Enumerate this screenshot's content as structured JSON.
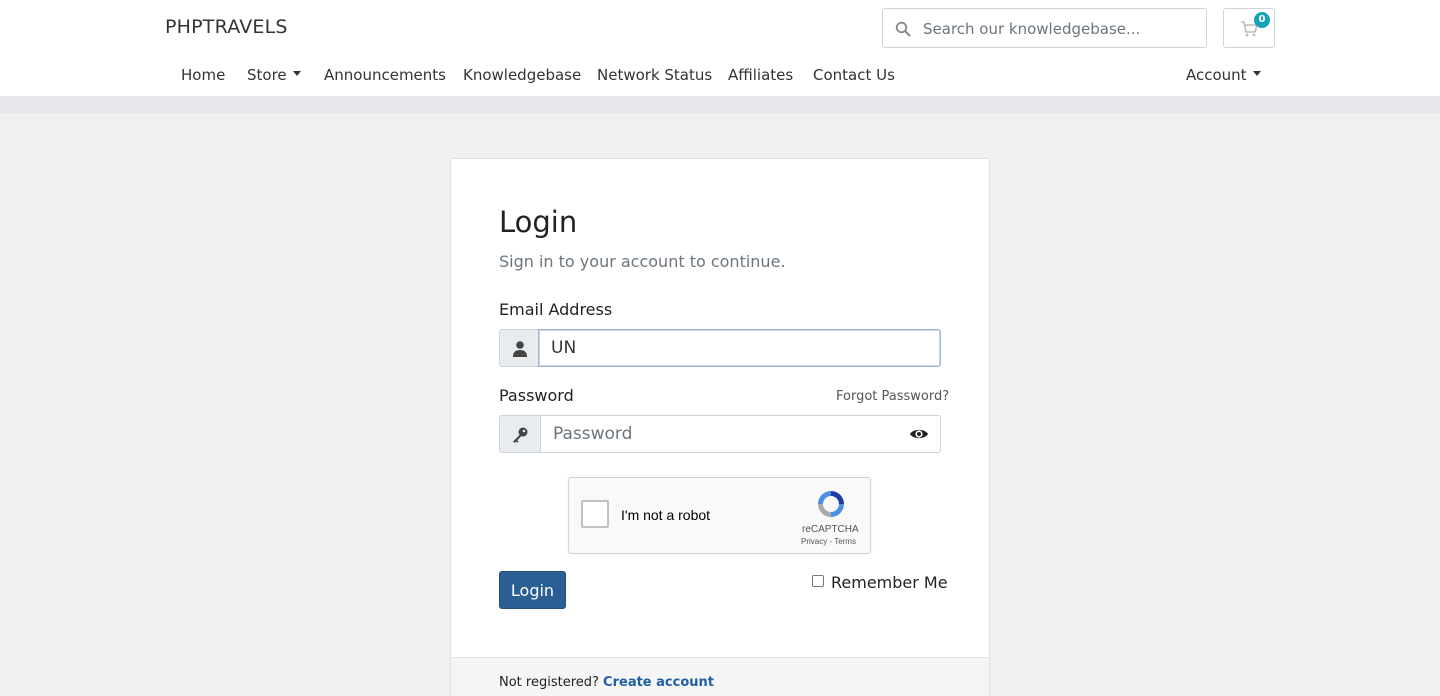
{
  "header": {
    "brand": "PHPTRAVELS",
    "search_placeholder": "Search our knowledgebase...",
    "cart_count": "0"
  },
  "nav": {
    "items": [
      {
        "label": "Home"
      },
      {
        "label": "Store"
      },
      {
        "label": "Announcements"
      },
      {
        "label": "Knowledgebase"
      },
      {
        "label": "Network Status"
      },
      {
        "label": "Affiliates"
      },
      {
        "label": "Contact Us"
      }
    ],
    "account_label": "Account"
  },
  "login": {
    "title": "Login",
    "subtitle": "Sign in to your account to continue.",
    "email_label": "Email Address",
    "email_value": "UN",
    "password_label": "Password",
    "password_placeholder": "Password",
    "forgot_label": "Forgot Password?",
    "recaptcha_text": "I'm not a robot",
    "recaptcha_brand": "reCAPTCHA",
    "recaptcha_links": "Privacy - Terms",
    "login_button": "Login",
    "remember_label": "Remember Me",
    "footer_text": "Not registered?",
    "footer_link": "Create account"
  },
  "colors": {
    "primary": "#2b5f93",
    "badge": "#17a2b8",
    "link": "#1f5fa6"
  }
}
